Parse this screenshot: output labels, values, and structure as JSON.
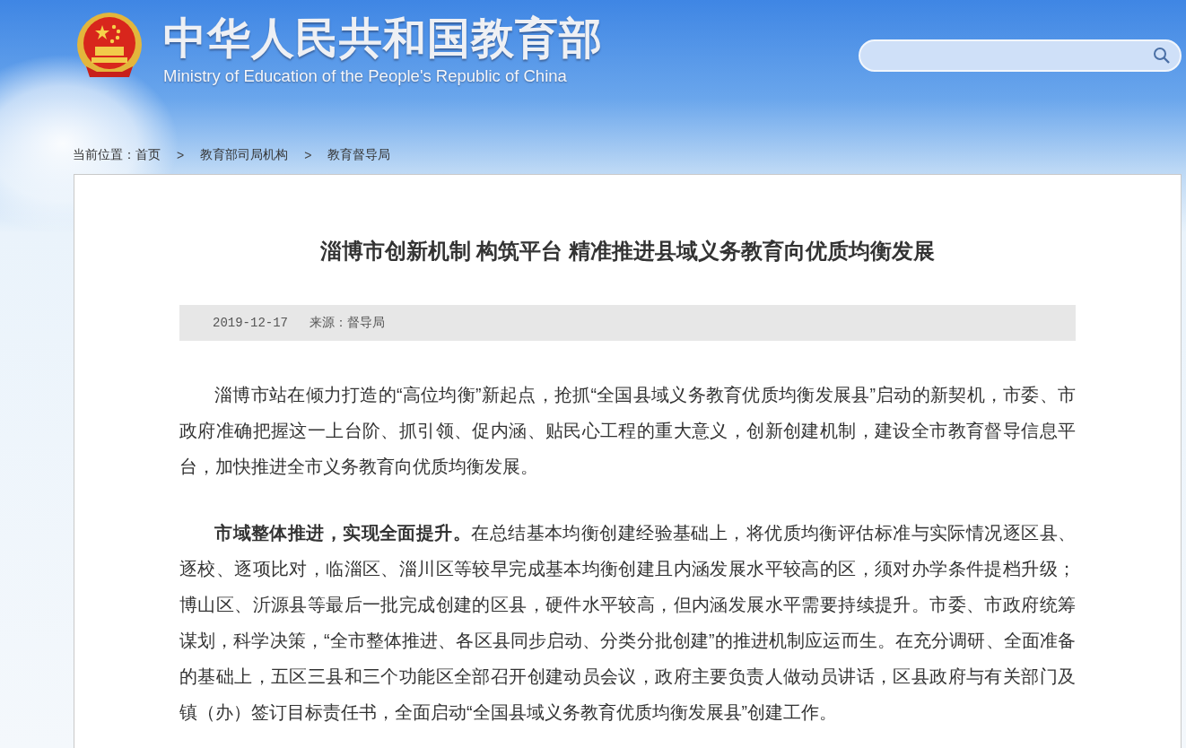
{
  "header": {
    "title": "中华人民共和国教育部",
    "subtitle": "Ministry of Education of the People's Republic of China"
  },
  "breadcrumb": {
    "label": "当前位置：",
    "items": [
      "首页",
      "教育部司局机构",
      "教育督导局"
    ],
    "separator": ">"
  },
  "article": {
    "title": "淄博市创新机制 构筑平台 精准推进县域义务教育向优质均衡发展",
    "date": "2019-12-17",
    "source": "来源：督导局",
    "paragraphs": [
      "淄博市站在倾力打造的“高位均衡”新起点，抢抓“全国县域义务教育优质均衡发展县”启动的新契机，市委、市政府准确把握这一上台阶、抓引领、促内涵、贴民心工程的重大意义，创新创建机制，建设全市教育督导信息平台，加快推进全市义务教育向优质均衡发展。",
      "**市域整体推进，实现全面提升。**在总结基本均衡创建经验基础上，将优质均衡评估标准与实际情况逐区县、逐校、逐项比对，临淄区、淄川区等较早完成基本均衡创建且内涵发展水平较高的区，须对办学条件提档升级；博山区、沂源县等最后一批完成创建的区县，硬件水平较高，但内涵发展水平需要持续提升。市委、市政府统筹谋划，科学决策，“全市整体推进、各区县同步启动、分类分批创建”的推进机制应运而生。在充分调研、全面准备的基础上，五区三县和三个功能区全部召开创建动员会议，政府主要负责人做动员讲话，区县政府与有关部门及镇（办）签订目标责任书，全面启动“全国县域义务教育优质均衡发展县”创建工作。"
    ]
  }
}
